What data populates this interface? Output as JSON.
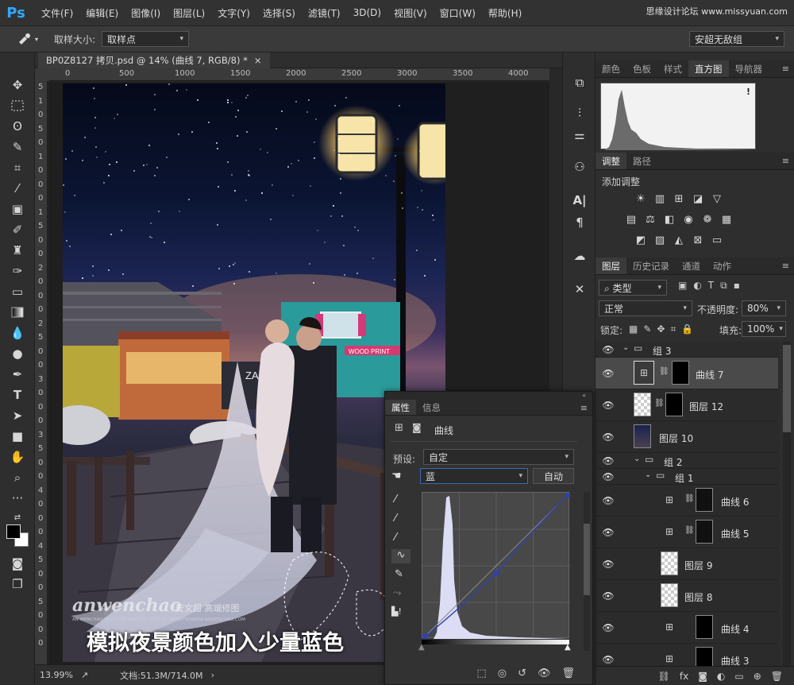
{
  "menubar": {
    "logo": "Ps",
    "items": [
      "文件(F)",
      "编辑(E)",
      "图像(I)",
      "图层(L)",
      "文字(Y)",
      "选择(S)",
      "滤镜(T)",
      "3D(D)",
      "视图(V)",
      "窗口(W)",
      "帮助(H)"
    ],
    "watermark": "思缘设计论坛 www.missyuan.com"
  },
  "options": {
    "sample_size_label": "取样大小:",
    "sample_size_value": "取样点",
    "workspace_value": "安超无敌组"
  },
  "document": {
    "tab_title": "BP0Z8127 拷贝.psd @ 14% (曲线 7, RGB/8) *",
    "close": "×",
    "ruler_h": [
      "0",
      "500",
      "1000",
      "1500",
      "2000",
      "2500",
      "3000",
      "3500",
      "4000"
    ],
    "ruler_v": [
      "5",
      "1",
      "0",
      "5",
      "0",
      "1",
      "0",
      "0",
      "0",
      "1",
      "5",
      "0",
      "0",
      "2",
      "0",
      "0",
      "0",
      "2",
      "5",
      "0",
      "0",
      "3",
      "0",
      "0",
      "0",
      "3",
      "5",
      "0",
      "0",
      "4",
      "0",
      "0",
      "0",
      "4",
      "5",
      "0",
      "0",
      "5",
      "0",
      "0",
      "0"
    ],
    "status_zoom": "13.99%",
    "status_doc": "文档:51.3M/714.0M"
  },
  "photo": {
    "sign_text": "WOOD PRINT",
    "store_text": "ZA",
    "brand": "anwenchao",
    "brand_cn": "安文超 高端修图",
    "brand_sub": "AN WENCHAO HIGH-END GRAPHIC OFFICIAL WEBSITE/WWW.ANWENCHAO.COM",
    "caption": "模拟夜景颜色加入少量蓝色"
  },
  "histogram_panel": {
    "tabs": [
      "颜色",
      "色板",
      "样式",
      "直方图",
      "导航器"
    ],
    "active": 3,
    "warning": "!"
  },
  "adjust_panel": {
    "tabs": [
      "调整",
      "路径"
    ],
    "add_label": "添加调整"
  },
  "layers_panel": {
    "tabs": [
      "图层",
      "历史记录",
      "通道",
      "动作"
    ],
    "filter_kind": "类型",
    "blend_mode": "正常",
    "opacity_label": "不透明度:",
    "opacity_value": "80%",
    "lock_label": "锁定:",
    "fill_label": "填充:",
    "fill_value": "100%",
    "layers": [
      {
        "name": "组 3",
        "type": "group"
      },
      {
        "name": "曲线 7",
        "type": "curves",
        "selected": true
      },
      {
        "name": "图层 12",
        "type": "pixel"
      },
      {
        "name": "图层 10",
        "type": "photo"
      },
      {
        "name": "组 2",
        "type": "group"
      },
      {
        "name": "组 1",
        "type": "group"
      },
      {
        "name": "曲线 6",
        "type": "curves"
      },
      {
        "name": "曲线 5",
        "type": "curves"
      },
      {
        "name": "图层 9",
        "type": "pixel"
      },
      {
        "name": "图层 8",
        "type": "pixel"
      },
      {
        "name": "曲线 4",
        "type": "curves"
      },
      {
        "name": "曲线 3",
        "type": "curves"
      }
    ]
  },
  "properties_panel": {
    "tabs": [
      "属性",
      "信息"
    ],
    "title": "曲线",
    "preset_label": "预设:",
    "preset_value": "自定",
    "channel_value": "蓝",
    "auto_label": "自动",
    "curve_points": [
      [
        0,
        0
      ],
      [
        0.5,
        0.45
      ],
      [
        1,
        1
      ]
    ]
  },
  "colors": {
    "accent": "#31a8ff",
    "bg": "#282828",
    "panel": "#2e2e2e"
  }
}
